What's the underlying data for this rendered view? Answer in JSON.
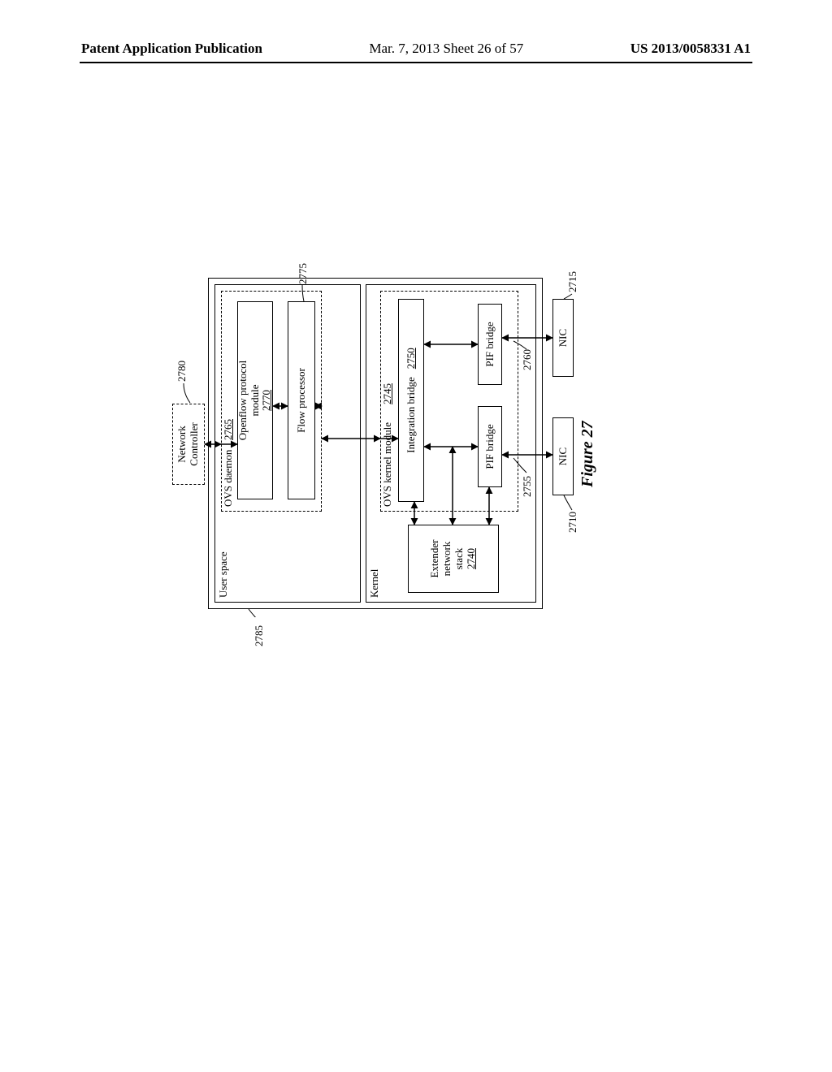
{
  "header": {
    "left": "Patent Application Publication",
    "center": "Mar. 7, 2013  Sheet 26 of 57",
    "right": "US 2013/0058331 A1"
  },
  "fig": {
    "caption": "Figure 27",
    "network_controller": "Network\nController",
    "user_space": "User space",
    "kernel": "Kernel",
    "ovs_daemon": "OVS daemon",
    "openflow": "Openflow protocol\nmodule",
    "flow_processor": "Flow processor",
    "ovs_kernel": "OVS kernel module",
    "integration_bridge": "Integration bridge",
    "pif_bridge_a": "PIF bridge",
    "pif_bridge_b": "PIF bridge",
    "extender": "Extender\nnetwork\nstack",
    "nic_a": "NIC",
    "nic_b": "NIC",
    "refs": {
      "net_ctrl": "2780",
      "ovs_daemon": "2765",
      "openflow": "2770",
      "flow_proc": "2775",
      "ovs_kernel": "2745",
      "int_bridge": "2750",
      "pif_a": "2755",
      "pif_b": "2760",
      "nic_a": "2710",
      "nic_b": "2715",
      "extender": "2740",
      "host": "2785"
    }
  }
}
